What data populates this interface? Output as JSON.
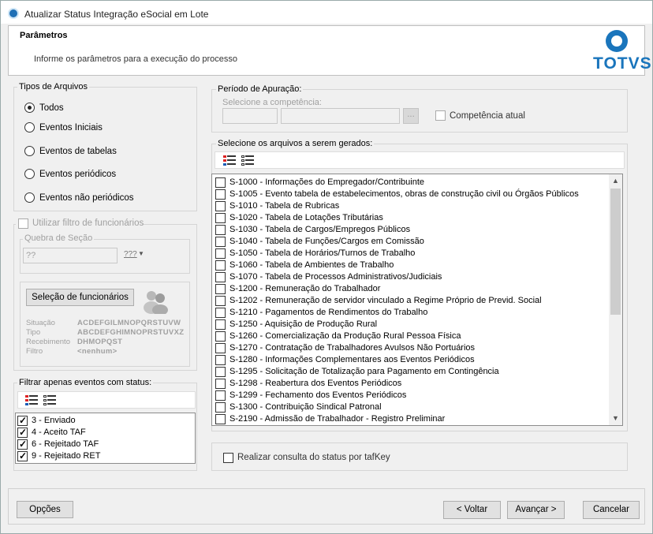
{
  "window": {
    "title": "Atualizar Status Integração eSocial em Lote"
  },
  "header": {
    "title": "Parâmetros",
    "subtitle": "Informe os parâmetros para a execução do processo",
    "logo_text": "TOTVS",
    "brand_color": "#1a75bc"
  },
  "tipos": {
    "legend": "Tipos de Arquivos",
    "options": [
      {
        "label": "Todos",
        "selected": true
      },
      {
        "label": "Eventos Iniciais",
        "selected": false
      },
      {
        "label": "Eventos de tabelas",
        "selected": false
      },
      {
        "label": "Eventos periódicos",
        "selected": false
      },
      {
        "label": "Eventos não periódicos",
        "selected": false
      }
    ]
  },
  "filtro_func": {
    "checkbox_label": "Utilizar filtro de funcionários",
    "checked": false,
    "quebra_label": "Quebra de Seção",
    "quebra_value": "??",
    "quebra_btn": "???",
    "selecao_btn": "Seleção de funcionários",
    "info": [
      {
        "label": "Situação",
        "value": "ACDEFGILMNOPQRSTUVW"
      },
      {
        "label": "Tipo",
        "value": "ABCDEFGHIMNOPRSTUVXZ"
      },
      {
        "label": "Recebimento",
        "value": "DHMOPQST"
      },
      {
        "label": "Filtro",
        "value": "<nenhum>"
      }
    ]
  },
  "status_filter": {
    "legend": "Filtrar apenas eventos com status:",
    "items": [
      {
        "label": "3 - Enviado",
        "checked": true
      },
      {
        "label": "4 - Aceito TAF",
        "checked": true
      },
      {
        "label": "6 - Rejeitado TAF",
        "checked": true
      },
      {
        "label": "9 - Rejeitado RET",
        "checked": true
      }
    ]
  },
  "periodo": {
    "legend": "Período de Apuração:",
    "competencia_label": "Selecione a competência:",
    "browse_btn": "...",
    "competencia_atual_label": "Competência atual",
    "competencia_atual_checked": false
  },
  "arquivos": {
    "legend": "Selecione os arquivos a serem gerados:",
    "items": [
      "S-1000 - Informações do Empregador/Contribuinte",
      "S-1005 - Evento tabela de estabelecimentos, obras de construção civil ou Órgãos Públicos",
      "S-1010 - Tabela de Rubricas",
      "S-1020 - Tabela de Lotações Tributárias",
      "S-1030 - Tabela de Cargos/Empregos Públicos",
      "S-1040 - Tabela de Funções/Cargos em Comissão",
      "S-1050 - Tabela de Horários/Turnos de Trabalho",
      "S-1060 - Tabela de Ambientes de Trabalho",
      "S-1070 - Tabela de Processos Administrativos/Judiciais",
      "S-1200 - Remuneração do Trabalhador",
      "S-1202 - Remuneração de servidor vinculado a Regime Próprio de Previd. Social",
      "S-1210 - Pagamentos de Rendimentos do Trabalho",
      "S-1250 - Aquisição de Produção Rural",
      "S-1260 - Comercialização da Produção Rural Pessoa Física",
      "S-1270 - Contratação de Trabalhadores Avulsos Não Portuários",
      "S-1280 - Informações Complementares aos Eventos Periódicos",
      "S-1295 - Solicitação de Totalização para Pagamento em Contingência",
      "S-1298 - Reabertura dos Eventos Periódicos",
      "S-1299 - Fechamento dos Eventos Periódicos",
      "S-1300 - Contribuição Sindical Patronal",
      "S-2190 - Admissão de Trabalhador - Registro Preliminar"
    ]
  },
  "tafkey": {
    "label": "Realizar consulta do status por tafKey",
    "checked": false
  },
  "footer": {
    "opcoes": "Opções",
    "voltar": "< Voltar",
    "avancar": "Avançar >",
    "cancelar": "Cancelar"
  }
}
